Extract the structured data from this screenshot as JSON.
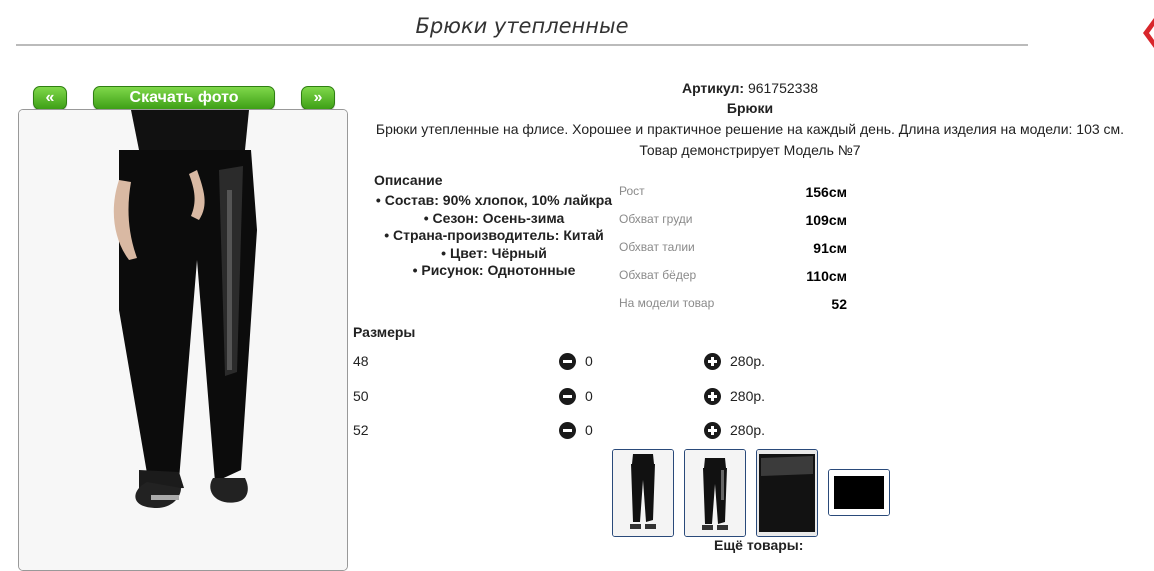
{
  "header": {
    "title": "Брюки утепленные"
  },
  "gallery": {
    "prev_label": "«",
    "download_label": "Скачать фото",
    "next_label": "»"
  },
  "product": {
    "article_label": "Артикул:",
    "article_value": "961752338",
    "type": "Брюки",
    "description": "Брюки утепленные на флисе. Хорошее и практичное решение на каждый день. Длина изделия на модели: 103 см.",
    "model_note": "Товар демонстрирует Модель №7"
  },
  "description_section": {
    "heading": "Описание",
    "items": [
      "Состав: 90% хлопок, 10% лайкра",
      "Сезон: Осень-зима",
      "Страна-производитель: Китай",
      "Цвет: Чёрный",
      "Рисунок: Однотонные"
    ]
  },
  "model_params": [
    {
      "label": "Рост",
      "value": "156см"
    },
    {
      "label": "Обхват груди",
      "value": "109см"
    },
    {
      "label": "Обхват талии",
      "value": "91см"
    },
    {
      "label": "Обхват бёдер",
      "value": "110см"
    },
    {
      "label": "На модели товар",
      "value": "52"
    }
  ],
  "sizes": {
    "heading": "Размеры",
    "rows": [
      {
        "size": "48",
        "qty": "0",
        "price": "280р."
      },
      {
        "size": "50",
        "qty": "0",
        "price": "280р."
      },
      {
        "size": "52",
        "qty": "0",
        "price": "280р."
      }
    ]
  },
  "more_products_label": "Ещё товары:",
  "colors": {
    "accent_green": "#3d9f16",
    "corner_red": "#d8262b",
    "thumb_border": "#2a4a7a"
  }
}
